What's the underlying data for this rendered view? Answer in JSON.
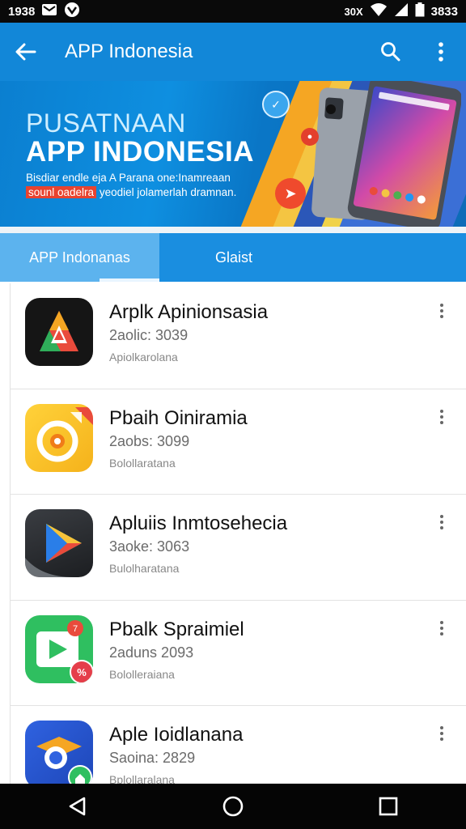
{
  "status_bar": {
    "time": "1938",
    "right_text": "3833",
    "signal_text": "30X"
  },
  "app_bar": {
    "title": "APP Indonesia",
    "back_icon": "arrow-back-icon",
    "search_icon": "search-icon",
    "more_icon": "more-vert-icon",
    "color": "#1287d8"
  },
  "banner": {
    "title_line1": "PUSATNAAN",
    "title_line2": "APP INDONESIA",
    "sub_line1": "Bisdiar endle eja A Parana one:Inamreaan",
    "sub_line2_highlight": "sounl oadelra",
    "sub_line2_rest": "yeodiel jolamerlah dramnan."
  },
  "tabs": [
    {
      "label": "APP Indonanas",
      "active": true
    },
    {
      "label": "Glaist",
      "active": false
    }
  ],
  "apps": [
    {
      "name": "Arplk Apinionsasia",
      "size": "2aolic: 3039",
      "category": "Apiolkarolana",
      "icon": "app-a-icon"
    },
    {
      "name": "Pbaih Oiniramia",
      "size": "2aobs: 3099",
      "category": "Bolollaratana",
      "icon": "app-target-icon"
    },
    {
      "name": "Apluiis Inmtosehecia",
      "size": "3aoke: 3063",
      "category": "Bulolharatana",
      "icon": "play-triangle-icon"
    },
    {
      "name": "Pbalk Spraimiel",
      "size": "2aduns 2093",
      "category": "Bololleraiana",
      "icon": "play-store-icon"
    },
    {
      "name": "Aple Ioidlanana",
      "size": "Saoina: 2829",
      "category": "Bplollaralana",
      "icon": "chrome-like-icon"
    }
  ],
  "nav_bar": {
    "back_icon": "nav-back-icon",
    "home_icon": "nav-home-icon",
    "recents_icon": "nav-recents-icon"
  }
}
